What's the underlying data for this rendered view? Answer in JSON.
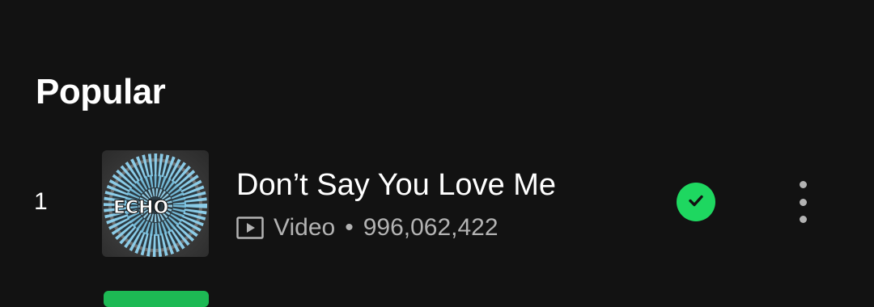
{
  "section": {
    "title": "Popular"
  },
  "tracks": [
    {
      "index": "1",
      "title": "Don’t Say You Love Me",
      "type_label": "Video",
      "separator": "•",
      "play_count": "996,062,422",
      "cover_text": "ECHO",
      "saved": true
    }
  ],
  "colors": {
    "background": "#121212",
    "accent": "#1ed760",
    "secondary_text": "#b3b3b3"
  },
  "icons": {
    "type": "video-icon",
    "saved": "check-circle-icon",
    "more": "more-vertical-icon"
  }
}
